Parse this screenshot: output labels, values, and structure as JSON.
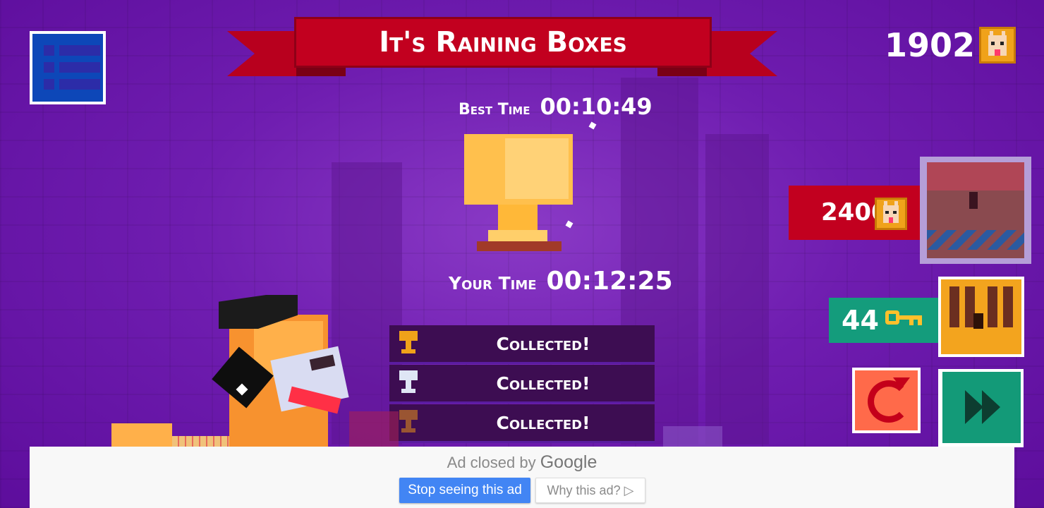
{
  "header": {
    "title": "It's Raining Boxes"
  },
  "coins": {
    "total": "1902",
    "icon": "coin-dog-icon"
  },
  "times": {
    "best_label": "Best Time",
    "best_value": "00:10:49",
    "your_label": "Your Time",
    "your_value": "00:12:25"
  },
  "collected": [
    {
      "trophy": "gold-trophy-icon",
      "color": "#f0a21a",
      "label": "Collected!"
    },
    {
      "trophy": "silver-trophy-icon",
      "color": "#dfe6f5",
      "label": "Collected!"
    },
    {
      "trophy": "bronze-trophy-icon",
      "color": "#9a5532",
      "label": "Collected!"
    }
  ],
  "shop": {
    "chest_price": "2400",
    "keys_count": "44"
  },
  "colors": {
    "banner": "#c2001f",
    "keys_panel": "#149c7c",
    "menu_button": "#0d47b8",
    "retry_button": "#ff6a4a",
    "next_button": "#139a78"
  },
  "ad": {
    "closed_text": "Ad closed by",
    "brand": "Google",
    "stop_label": "Stop seeing this ad",
    "why_label": "Why this ad?",
    "why_icon": "▷"
  }
}
